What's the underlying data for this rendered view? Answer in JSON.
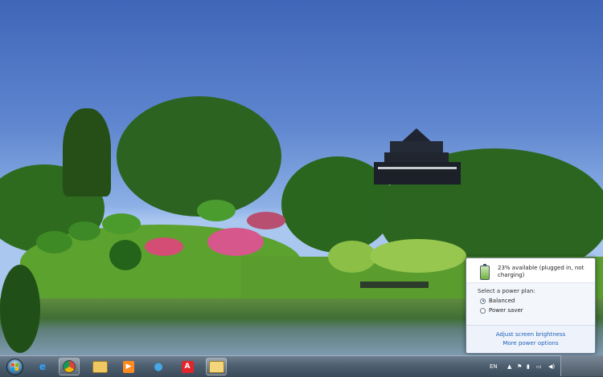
{
  "battery": {
    "status": "23% available (plugged in, not charging)"
  },
  "power_plans": {
    "title": "Select a power plan:",
    "options": [
      {
        "label": "Balanced",
        "selected": true
      },
      {
        "label": "Power saver",
        "selected": false
      }
    ]
  },
  "links": {
    "brightness": "Adjust screen brightness",
    "more": "More power options"
  },
  "taskbar": {
    "language": "EN",
    "apps": [
      "Windows Explorer",
      "Internet Explorer",
      "Chrome",
      "File Manager",
      "Media Player",
      "People",
      "Avira",
      "Folder"
    ]
  },
  "icons": {
    "start": "windows-start-icon",
    "battery": "battery-icon",
    "action_center": "flag-icon",
    "network": "network-icon",
    "volume": "volume-icon"
  },
  "colors": {
    "link": "#1f5fb8",
    "taskbar": "#4d5f70"
  }
}
